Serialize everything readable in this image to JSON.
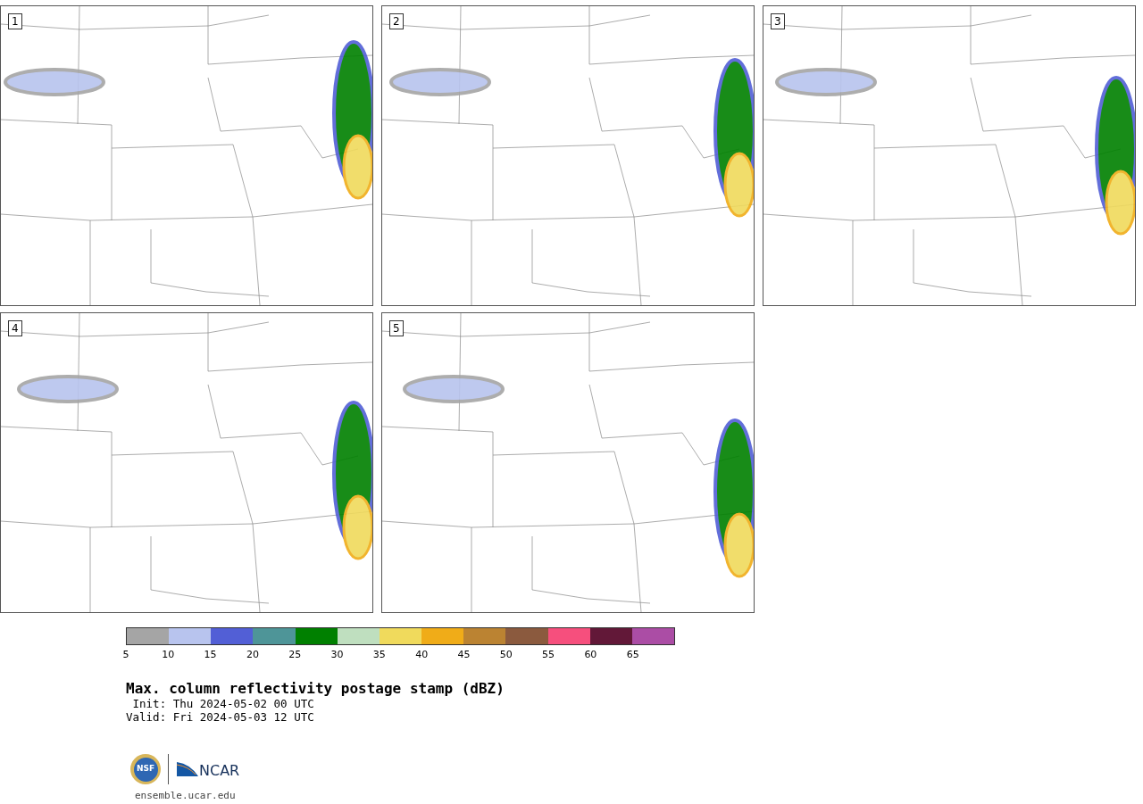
{
  "panels": [
    {
      "label": "1"
    },
    {
      "label": "2"
    },
    {
      "label": "3"
    },
    {
      "label": "4"
    },
    {
      "label": "5"
    }
  ],
  "colorbar": {
    "bins": [
      {
        "color": "#a5a5a5"
      },
      {
        "color": "#b8c4ee"
      },
      {
        "color": "#525fd6"
      },
      {
        "color": "#4e9598"
      },
      {
        "color": "#008000"
      },
      {
        "color": "#bfdfbf"
      },
      {
        "color": "#f0da5c"
      },
      {
        "color": "#f0ac18"
      },
      {
        "color": "#bb8332"
      },
      {
        "color": "#8b5a3e"
      },
      {
        "color": "#f64f7d"
      },
      {
        "color": "#621838"
      },
      {
        "color": "#ab4da5"
      }
    ],
    "ticks": [
      "5",
      "10",
      "15",
      "20",
      "25",
      "30",
      "35",
      "40",
      "45",
      "50",
      "55",
      "60",
      "65"
    ]
  },
  "title": "Max. column reflectivity postage stamp (dBZ)",
  "init": " Init: Thu 2024-05-02 00 UTC",
  "valid": "Valid: Fri 2024-05-03 12 UTC",
  "logos": {
    "nsf": "NSF",
    "ncar": "NCAR"
  },
  "footer": "ensemble.ucar.edu"
}
